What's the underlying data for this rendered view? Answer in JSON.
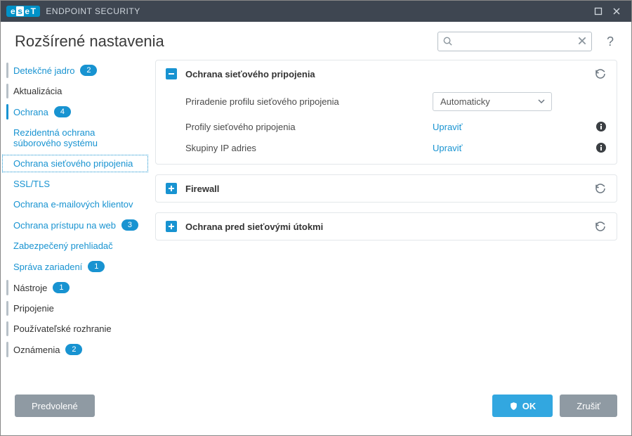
{
  "titlebar": {
    "product": "ENDPOINT SECURITY"
  },
  "header": {
    "page_title": "Rozšírené nastavenia",
    "search_placeholder": ""
  },
  "sidebar": [
    {
      "id": "detect",
      "label": "Detekčné jadro",
      "badge": "2",
      "kind": "top",
      "blue": true,
      "active": false
    },
    {
      "id": "update",
      "label": "Aktualizácia",
      "badge": null,
      "kind": "top",
      "blue": false,
      "active": false
    },
    {
      "id": "protect",
      "label": "Ochrana",
      "badge": "4",
      "kind": "top",
      "blue": true,
      "active": true
    },
    {
      "id": "rtfs",
      "label": "Rezidentná ochrana súborového systému",
      "kind": "sub"
    },
    {
      "id": "netprot",
      "label": "Ochrana sieťového pripojenia",
      "kind": "sub",
      "selected": true
    },
    {
      "id": "ssltls",
      "label": "SSL/TLS",
      "kind": "sub"
    },
    {
      "id": "mail",
      "label": "Ochrana e-mailových klientov",
      "kind": "sub"
    },
    {
      "id": "web",
      "label": "Ochrana prístupu na web",
      "badge": "3",
      "kind": "sub"
    },
    {
      "id": "browser",
      "label": "Zabezpečený prehliadač",
      "kind": "sub"
    },
    {
      "id": "devmgmt",
      "label": "Správa zariadení",
      "badge": "1",
      "kind": "sub"
    },
    {
      "id": "tools",
      "label": "Nástroje",
      "badge": "1",
      "kind": "top",
      "blue": false
    },
    {
      "id": "conn",
      "label": "Pripojenie",
      "badge": null,
      "kind": "top",
      "blue": false
    },
    {
      "id": "ui",
      "label": "Používateľské rozhranie",
      "badge": null,
      "kind": "top",
      "blue": false
    },
    {
      "id": "notif",
      "label": "Oznámenia",
      "badge": "2",
      "kind": "top",
      "blue": false
    }
  ],
  "panels": {
    "net": {
      "title": "Ochrana sieťového pripojenia",
      "rows": [
        {
          "label": "Priradenie profilu sieťového pripojenia",
          "control": "select",
          "value": "Automaticky"
        },
        {
          "label": "Profily sieťového pripojenia",
          "control": "link",
          "value": "Upraviť",
          "info": true
        },
        {
          "label": "Skupiny IP adries",
          "control": "link",
          "value": "Upraviť",
          "info": true
        }
      ]
    },
    "fw": {
      "title": "Firewall"
    },
    "nap": {
      "title": "Ochrana pred sieťovými útokmi"
    }
  },
  "footer": {
    "default": "Predvolené",
    "ok": "OK",
    "cancel": "Zrušiť"
  }
}
